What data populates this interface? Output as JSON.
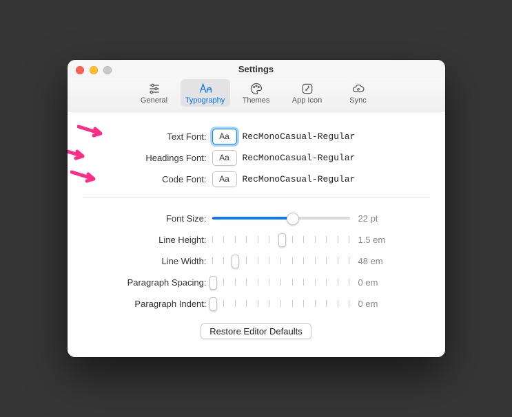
{
  "window": {
    "title": "Settings"
  },
  "toolbar": {
    "items": [
      {
        "id": "general",
        "label": "General"
      },
      {
        "id": "typography",
        "label": "Typography"
      },
      {
        "id": "themes",
        "label": "Themes"
      },
      {
        "id": "appicon",
        "label": "App Icon"
      },
      {
        "id": "sync",
        "label": "Sync"
      }
    ],
    "selected": "typography"
  },
  "fonts": {
    "text": {
      "label": "Text Font:",
      "button": "Aa",
      "value": "RecMonoCasual-Regular",
      "focused": true
    },
    "headings": {
      "label": "Headings Font:",
      "button": "Aa",
      "value": "RecMonoCasual-Regular",
      "focused": false
    },
    "code": {
      "label": "Code Font:",
      "button": "Aa",
      "value": "RecMonoCasual-Regular",
      "focused": false
    }
  },
  "sliders": {
    "fontSize": {
      "label": "Font Size:",
      "valueText": "22 pt",
      "percent": 58,
      "style": "round",
      "filled": true
    },
    "lineHeight": {
      "label": "Line Height:",
      "valueText": "1.5 em",
      "percent": 50,
      "style": "tall",
      "filled": false
    },
    "lineWidth": {
      "label": "Line Width:",
      "valueText": "48 em",
      "percent": 16,
      "style": "tall",
      "filled": false
    },
    "paragraphSpacing": {
      "label": "Paragraph Spacing:",
      "valueText": "0 em",
      "percent": 0,
      "style": "tall",
      "filled": false
    },
    "paragraphIndent": {
      "label": "Paragraph Indent:",
      "valueText": "0 em",
      "percent": 0,
      "style": "tall",
      "filled": false
    }
  },
  "actions": {
    "restore": "Restore Editor Defaults"
  },
  "annotations": {
    "arrows": 3
  },
  "colors": {
    "accent": "#0a7aff",
    "annotation": "#ff2d86"
  }
}
